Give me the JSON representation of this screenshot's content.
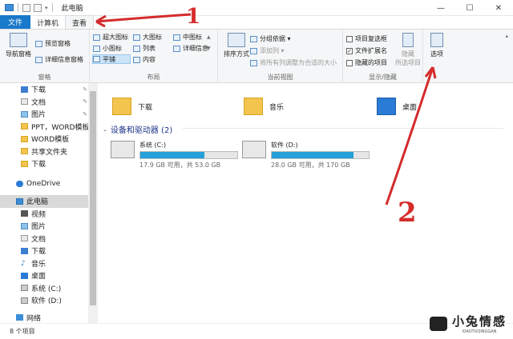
{
  "window": {
    "title": "此电脑",
    "controls": [
      "—",
      "☐",
      "✕"
    ]
  },
  "tabs": {
    "file": "文件",
    "computer": "计算机",
    "view": "查看"
  },
  "ribbon": {
    "panes": {
      "nav_pane": "导航窗格",
      "preview_pane": "预览窗格",
      "details_pane": "详细信息窗格",
      "label": "窗格"
    },
    "layout": {
      "items": [
        "超大图标",
        "大图标",
        "中图标",
        "小图标",
        "列表",
        "详细信息",
        "平铺",
        "内容"
      ],
      "label": "布局"
    },
    "current_view": {
      "sort": "排序方式",
      "group_by": "分组依据 ▾",
      "add_column": "添加列 ▾",
      "size_all": "将所有列调整为合适的大小",
      "label": "当前视图"
    },
    "show_hide": {
      "item_checkbox": "项目复选框",
      "file_ext": "文件扩展名",
      "hidden_items": "隐藏的项目",
      "hide": "隐藏",
      "selected_items": "所选项目",
      "label": "显示/隐藏",
      "file_ext_checked": true
    },
    "options": {
      "label": "选项"
    }
  },
  "nav": {
    "quick_access": [
      {
        "label": "下载",
        "pinned": true
      },
      {
        "label": "文档",
        "pinned": true
      },
      {
        "label": "图片",
        "pinned": true
      },
      {
        "label": "PPT，WORD模板",
        "pinned": false
      },
      {
        "label": "WORD模板",
        "pinned": false
      },
      {
        "label": "共享文件夹",
        "pinned": false
      },
      {
        "label": "下载",
        "pinned": false
      }
    ],
    "onedrive": "OneDrive",
    "this_pc": "此电脑",
    "pc_items": [
      "视频",
      "图片",
      "文档",
      "下载",
      "音乐",
      "桌面",
      "系统 (C:)",
      "软件 (D:)"
    ],
    "network": "网络"
  },
  "main": {
    "folders": [
      "下载",
      "音乐",
      "桌面"
    ],
    "section_title": "设备和驱动器 (2)",
    "drives": [
      {
        "name": "系统 (C:)",
        "size": "17.9 GB 可用，共 53.0 GB",
        "used_fraction": 0.66
      },
      {
        "name": "软件 (D:)",
        "size": "28.0 GB 可用，共 170 GB",
        "used_fraction": 0.84
      }
    ]
  },
  "status": {
    "count": "8 个项目"
  },
  "annotations": {
    "step1": "1",
    "step2": "2",
    "color": "#d42c2c"
  },
  "watermark": {
    "title": "小兔情感",
    "sub": "XIAOTUQINGGAN"
  }
}
